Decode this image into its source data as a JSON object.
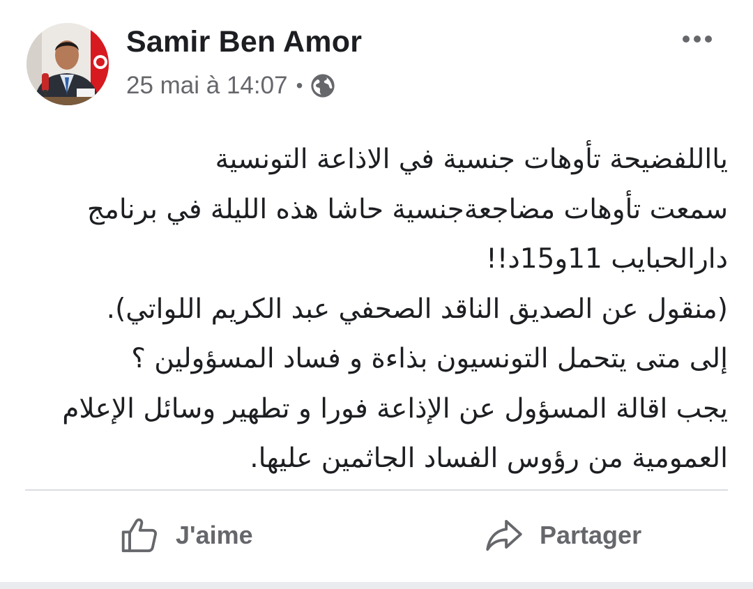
{
  "post": {
    "author": "Samir Ben Amor",
    "timestamp": "25 mai à 14:07",
    "separator": "•",
    "privacy_icon": "globe-icon",
    "more_icon": "more-options-icon",
    "body_lines": [
      "يااللفضيحة تأوهات جنسية في الاذاعة التونسية",
      "سمعت تأوهات مضاجعةجنسية حاشا هذه الليلة في برنامج",
      "دارالحبايب 11و15د!!",
      "(منقول عن الصديق الناقد الصحفي عبد الكريم اللواتي).",
      "إلى متى يتحمل التونسيون بذاءة و فساد المسؤولين ؟",
      "يجب اقالة المسؤول عن الإذاعة فورا و تطهير وسائل الإعلام",
      "العمومية من رؤوس الفساد الجاثمين عليها."
    ]
  },
  "actions": {
    "like_label": "J'aime",
    "like_icon": "thumbs-up-icon",
    "share_label": "Partager",
    "share_icon": "share-arrow-icon"
  },
  "colors": {
    "text_primary": "#1c1e21",
    "text_secondary": "#65676b",
    "divider": "#dadde1"
  }
}
